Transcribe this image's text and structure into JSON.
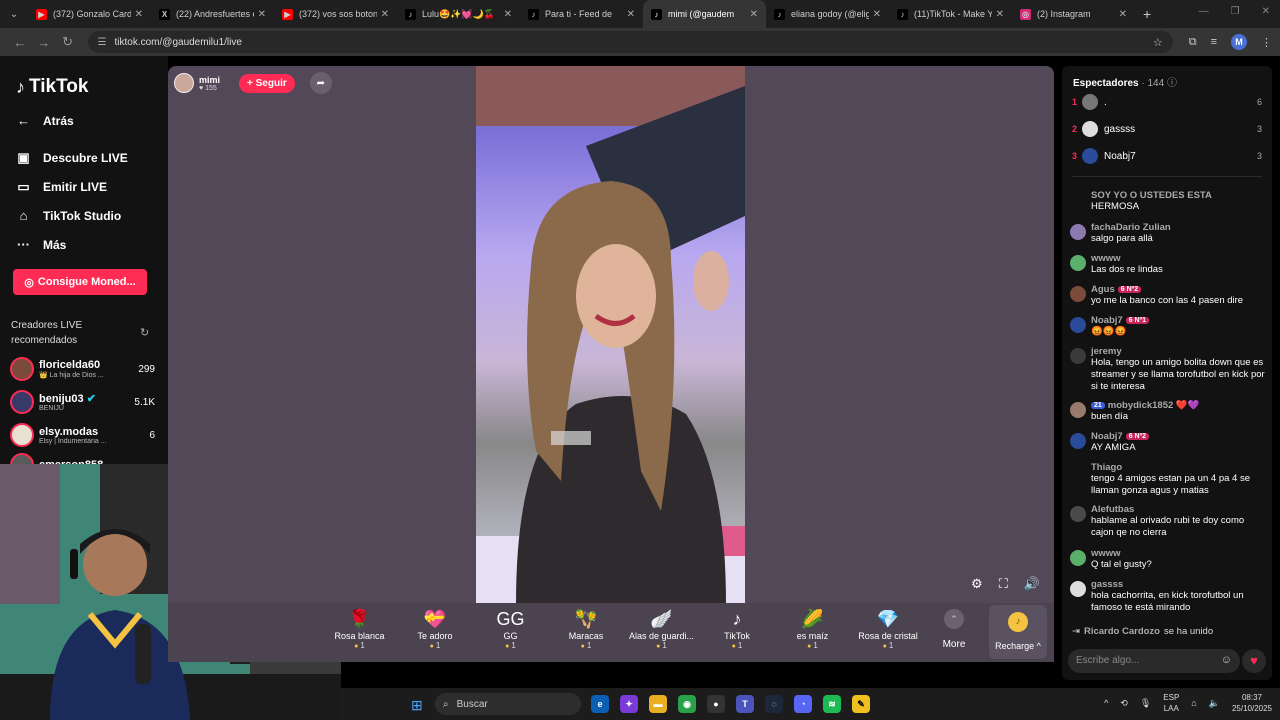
{
  "browser": {
    "tabs": [
      {
        "title": "(372) Gonzalo Cardo",
        "icon": "youtube-icon",
        "color": "#ff0000"
      },
      {
        "title": "(22) Andresfuertes er",
        "icon": "x-icon",
        "color": "#000000"
      },
      {
        "title": "(372) vos sos boton l",
        "icon": "youtube-icon",
        "color": "#ff0000"
      },
      {
        "title": "Lulu🤩✨💓🌙🍒",
        "icon": "tiktok-icon",
        "color": "#000000"
      },
      {
        "title": "Para ti - Feed de",
        "icon": "tiktok-icon",
        "color": "#000000"
      },
      {
        "title": "mimi (@gaudem",
        "icon": "tiktok-icon",
        "color": "#000000",
        "active": true
      },
      {
        "title": "eliana godoy (@elig",
        "icon": "tiktok-icon",
        "color": "#000000"
      },
      {
        "title": "(11)TikTok - Make Yo",
        "icon": "tiktok-icon",
        "color": "#000000"
      },
      {
        "title": "(2) Instagram",
        "icon": "instagram-icon",
        "color": "#d62976"
      }
    ],
    "url": "tiktok.com/@gaudemilu1/live",
    "profile_initial": "M"
  },
  "sidebar": {
    "logo": "TikTok",
    "back": "Atrás",
    "items": [
      {
        "label": "Descubre LIVE",
        "icon": "live-tv-icon"
      },
      {
        "label": "Emitir LIVE",
        "icon": "video-camera-icon"
      },
      {
        "label": "TikTok Studio",
        "icon": "studio-icon"
      },
      {
        "label": "Más",
        "icon": "more-icon"
      }
    ],
    "coins_button": "Consigue Moned...",
    "recommended_title": "Creadores LIVE recomendados",
    "creators": [
      {
        "name": "floricelda60",
        "sub": "👑 La hija de Dios ...",
        "count": "299",
        "color": "#7a4a3a"
      },
      {
        "name": "beniju03",
        "sub": "BENIJU",
        "count": "5.1K",
        "color": "#3a3a6a",
        "verified": true
      },
      {
        "name": "elsy.modas",
        "sub": "Elsy | Indumentaria ...",
        "count": "6",
        "color": "#e8e0d0"
      },
      {
        "name": "emerson858...",
        "sub": "",
        "count": "",
        "color": "#5a5a5a"
      }
    ]
  },
  "stream": {
    "host_name": "mimi",
    "host_likes": "155",
    "follow_label": "+ Seguir",
    "gifts": [
      {
        "name": "Rosa blanca",
        "price": "1",
        "icon": "🌹"
      },
      {
        "name": "Te adoro",
        "price": "1",
        "icon": "💝"
      },
      {
        "name": "GG",
        "price": "1",
        "icon": "GG"
      },
      {
        "name": "Maracas",
        "price": "1",
        "icon": "🪇"
      },
      {
        "name": "Alas de guardi...",
        "price": "1",
        "icon": "🪽"
      },
      {
        "name": "TikTok",
        "price": "1",
        "icon": "♪"
      },
      {
        "name": "es maíz",
        "price": "1",
        "icon": "🌽"
      },
      {
        "name": "Rosa de cristal",
        "price": "1",
        "icon": "💎"
      }
    ],
    "more_label": "More",
    "recharge_label": "Recharge ^"
  },
  "chat": {
    "viewers_label": "Espectadores",
    "viewers_count": "144",
    "top_viewers": [
      {
        "rank": "1",
        "name": ".",
        "score": "6",
        "color": "#777777"
      },
      {
        "rank": "2",
        "name": "gassss",
        "score": "3",
        "color": "#dddddd"
      },
      {
        "rank": "3",
        "name": "Noabj7",
        "score": "3",
        "color": "#2a4a9a"
      }
    ],
    "messages": [
      {
        "user": "SOY YO O USTEDES ESTA",
        "text": "HERMOSA",
        "badge": "",
        "color": "#121212"
      },
      {
        "user": "fachaDario Zulian",
        "text": "salgo para allá",
        "badge": "",
        "color": "#8a7ab0"
      },
      {
        "user": "wwww",
        "text": "Las dos re lindas",
        "badge": "",
        "color": "#5ab06a"
      },
      {
        "user": "Agus",
        "text": "yo me la banco con las 4 pasen dire",
        "badge": "6 Nº2",
        "color": "#7a4a3a"
      },
      {
        "user": "Noabj7",
        "text": "😡😡😡",
        "badge": "6 Nº1",
        "color": "#2a4a9a"
      },
      {
        "user": "jeremy",
        "text": "Hola, tengo un amigo bolita down que es streamer y se llama torofutbol en kick por si te interesa",
        "badge": "",
        "color": "#3a3a3a"
      },
      {
        "user": "mobydick1852 ❤️💜",
        "text": "buen día",
        "badge": "21",
        "color": "#9a7a6a"
      },
      {
        "user": "Noabj7",
        "text": "AY AMIGA",
        "badge": "6 Nº2",
        "color": "#2a4a9a"
      },
      {
        "user": "Thiago",
        "text": "tengo 4 amigos estan pa un 4 pa 4 se llaman gonza agus y matias",
        "badge": "",
        "color": "#111111"
      },
      {
        "user": "Alefutbas",
        "text": "hablame al orivado rubi te doy como cajon qe no cierra",
        "badge": "",
        "color": "#4a4a4a"
      },
      {
        "user": "wwww",
        "text": "Q tal el gusty?",
        "badge": "",
        "color": "#5ab06a"
      },
      {
        "user": "gassss",
        "text": "hola cachorrita, en kick torofutbol un famoso te está mirando",
        "badge": "",
        "color": "#dddddd"
      }
    ],
    "joined_user": "Ricardo Cardozo",
    "joined_text": "se ha unido",
    "input_placeholder": "Escribe algo..."
  },
  "taskbar": {
    "search_label": "Buscar",
    "lang_top": "ESP",
    "lang_bottom": "LAA",
    "time": "08:37",
    "date": "25/10/2025"
  }
}
